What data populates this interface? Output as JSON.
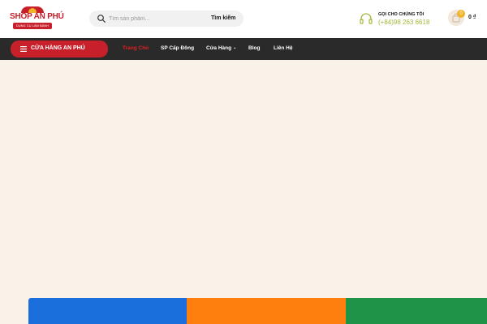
{
  "header": {
    "logo": {
      "name": "SHOP AN PHÚ",
      "tagline": "DỤNG CỤ LÀM BÁNH"
    },
    "search": {
      "placeholder": "Tìm sản phẩm...",
      "value": "",
      "button_label": "Tìm kiếm",
      "icon": "search-icon"
    },
    "hotline": {
      "label": "GỌI CHO CHÚNG TÔI",
      "number": "(+84)98 263 6618",
      "icon": "headset-icon",
      "color": "#a3b83b"
    },
    "cart": {
      "count": "0",
      "total": "0 ₫",
      "icon": "shopping-bag-icon"
    }
  },
  "nav": {
    "store_button": {
      "label": "CỬA HÀNG AN PHÚ",
      "icon": "menu-icon",
      "color": "#c8202a"
    },
    "items": [
      {
        "label": "Trang Chủ",
        "active": true
      },
      {
        "label": "SP Cấp Đông",
        "active": false
      },
      {
        "label": "Cửa Hàng",
        "active": false,
        "has_dropdown": true
      },
      {
        "label": "Blog",
        "active": false
      },
      {
        "label": "Liên Hệ",
        "active": false
      }
    ]
  },
  "colors": {
    "brand_red": "#c8202a",
    "nav_background": "#2a2a2a",
    "hero_background": "#faf2e8",
    "card_blue": "#1a6fdc",
    "card_orange": "#ff7f0e",
    "card_green": "#1f9449"
  }
}
